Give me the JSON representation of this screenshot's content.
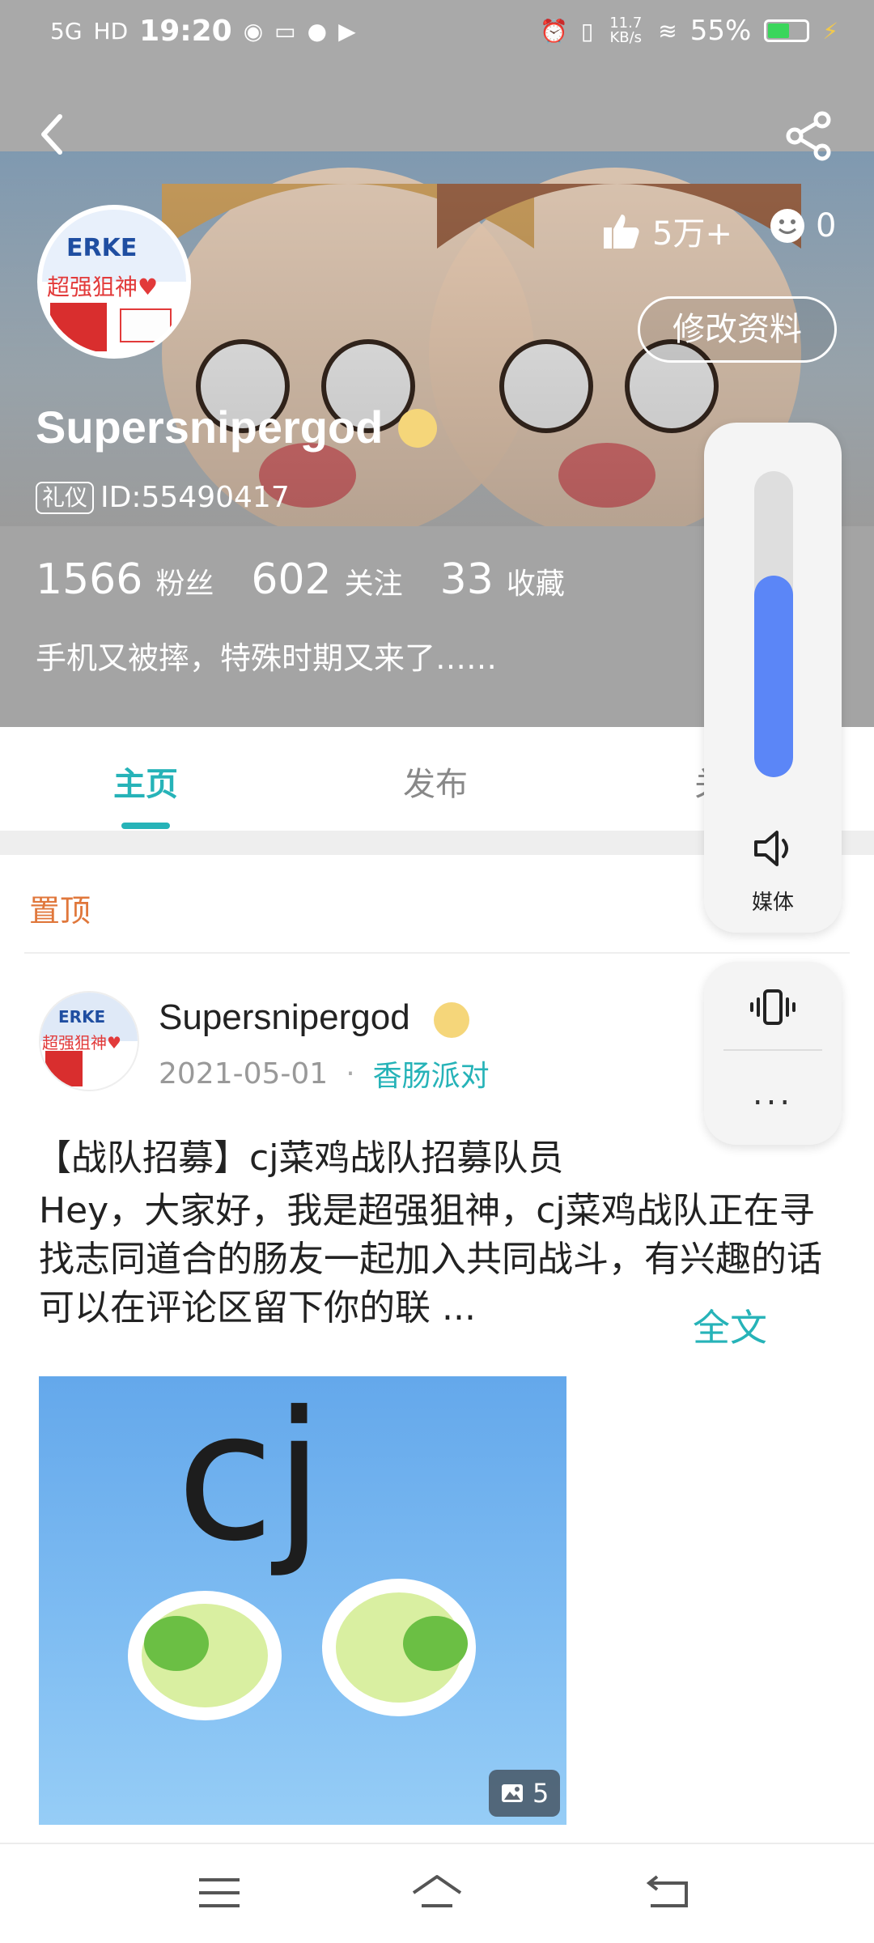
{
  "status_bar": {
    "network": "5G",
    "hd": "HD",
    "time": "19:20",
    "speed": "11.7 KB/s",
    "battery": "55%",
    "battery_level": 0.55
  },
  "profile": {
    "likes": "5万+",
    "smile_count": "0",
    "edit_label": "修改资料",
    "username": "Supersnipergod",
    "id_tag": "礼仪",
    "id_text": "ID:55490417",
    "fans_count": "1566",
    "fans_label": "粉丝",
    "following_count": "602",
    "following_label": "关注",
    "favorites_count": "33",
    "favorites_label": "收藏",
    "bio": "手机又被摔，特殊时期又来了……",
    "avatar_text": "超强狙神♥",
    "avatar_logo": "ERKE"
  },
  "tabs": [
    {
      "label": "主页",
      "active": true
    },
    {
      "label": "发布",
      "active": false
    },
    {
      "label": "关",
      "active": false
    }
  ],
  "pinned_label": "置顶",
  "post": {
    "author": "Supersnipergod",
    "date": "2021-05-01",
    "separator": "·",
    "tag": "香肠派对",
    "title": "【战队招募】cj菜鸡战队招募队员",
    "body": "Hey，大家好，我是超强狙神，cj菜鸡战队正在寻找志同道合的肠友一起加入共同战斗，有兴趣的话可以在评论区留下你的联 ...",
    "more_label": "全文",
    "image_text": "cj",
    "image_count": "5"
  },
  "volume_panel": {
    "level": 0.66,
    "label": "媒体",
    "accent": "#5b86f7"
  },
  "mode_panel": {
    "more": "..."
  },
  "colors": {
    "accent": "#26b3b8",
    "pinned": "#e0773b"
  }
}
